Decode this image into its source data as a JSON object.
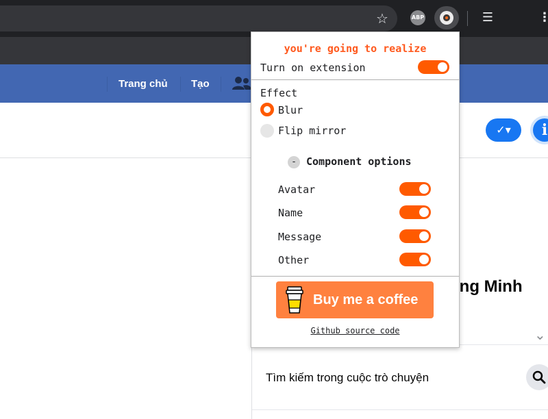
{
  "browser": {
    "star_icon": "star-icon",
    "abp_label": "ABP",
    "extension_icon": "blur-extension-icon",
    "playlist_icon": "media-playlist-icon",
    "menu_icon": "more-vert-icon"
  },
  "facebook": {
    "nav": {
      "home": "Trang chủ",
      "create": "Tạo"
    },
    "friends_icon": "friends-icon",
    "profile_name_fragment": "ong Minh",
    "search_conversation": "Tìm kiếm trong cuộc trò chuyện",
    "search_icon": "search-icon",
    "check_icon": "✓▾",
    "info_icon": "i",
    "chevron_icon": "⌄",
    "colors": {
      "header_bg": "#4267b2",
      "accent_blue": "#1877f2"
    }
  },
  "popup": {
    "title": "you're going to realize",
    "turn_on_label": "Turn on extension",
    "turn_on_enabled": true,
    "effect_label": "Effect",
    "effects": [
      {
        "label": "Blur",
        "selected": true
      },
      {
        "label": "Flip mirror",
        "selected": false
      }
    ],
    "component_toggle_symbol": "-",
    "component_options_label": "Component options",
    "components": [
      {
        "label": "Avatar",
        "enabled": true
      },
      {
        "label": "Name",
        "enabled": true
      },
      {
        "label": "Message",
        "enabled": true
      },
      {
        "label": "Other",
        "enabled": true
      }
    ],
    "coffee_label": "Buy me a coffee",
    "coffee_icon": "coffee-cup-icon",
    "github_link": "Github source code",
    "colors": {
      "accent": "#ff5a00",
      "title": "#ff5a1f",
      "coffee_button": "#ff813f"
    }
  }
}
